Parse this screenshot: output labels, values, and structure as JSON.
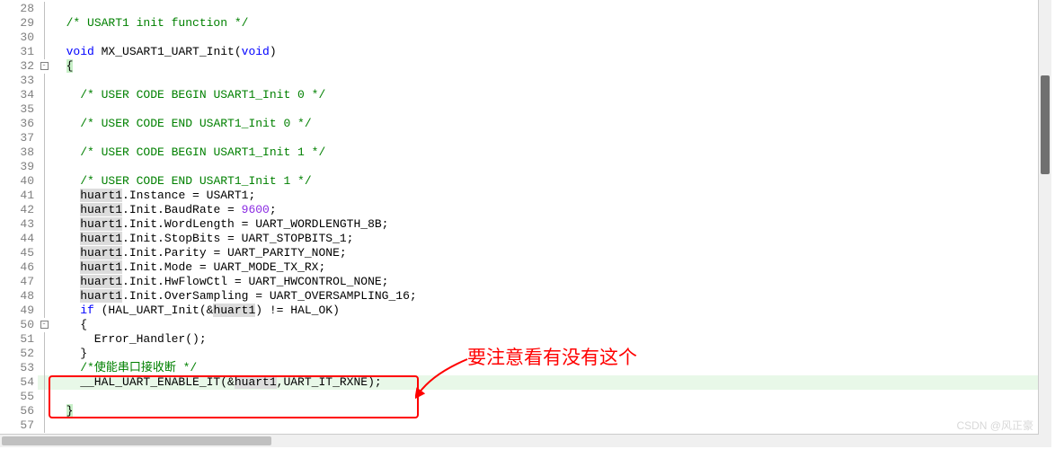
{
  "gutter_start": 28,
  "lines": [
    {
      "n": 28,
      "fold": "line",
      "segments": []
    },
    {
      "n": 29,
      "fold": "line",
      "segments": [
        {
          "t": "  ",
          "c": ""
        },
        {
          "t": "/* USART1 init function */",
          "c": "cmt"
        }
      ]
    },
    {
      "n": 30,
      "fold": "line",
      "segments": []
    },
    {
      "n": 31,
      "fold": "line",
      "segments": [
        {
          "t": "  ",
          "c": ""
        },
        {
          "t": "void",
          "c": "kw"
        },
        {
          "t": " MX_USART1_UART_Init(",
          "c": ""
        },
        {
          "t": "void",
          "c": "kw"
        },
        {
          "t": ")",
          "c": ""
        }
      ]
    },
    {
      "n": 32,
      "fold": "minus",
      "segments": [
        {
          "t": "  ",
          "c": ""
        },
        {
          "t": "{",
          "c": "bh"
        }
      ]
    },
    {
      "n": 33,
      "fold": "line",
      "segments": []
    },
    {
      "n": 34,
      "fold": "line",
      "segments": [
        {
          "t": "    ",
          "c": ""
        },
        {
          "t": "/* USER CODE BEGIN USART1_Init 0 */",
          "c": "cmt"
        }
      ]
    },
    {
      "n": 35,
      "fold": "line",
      "segments": []
    },
    {
      "n": 36,
      "fold": "line",
      "segments": [
        {
          "t": "    ",
          "c": ""
        },
        {
          "t": "/* USER CODE END USART1_Init 0 */",
          "c": "cmt"
        }
      ]
    },
    {
      "n": 37,
      "fold": "line",
      "segments": []
    },
    {
      "n": 38,
      "fold": "line",
      "segments": [
        {
          "t": "    ",
          "c": ""
        },
        {
          "t": "/* USER CODE BEGIN USART1_Init 1 */",
          "c": "cmt"
        }
      ]
    },
    {
      "n": 39,
      "fold": "line",
      "segments": []
    },
    {
      "n": 40,
      "fold": "line",
      "segments": [
        {
          "t": "    ",
          "c": ""
        },
        {
          "t": "/* USER CODE END USART1_Init 1 */",
          "c": "cmt"
        }
      ]
    },
    {
      "n": 41,
      "fold": "line",
      "segments": [
        {
          "t": "    ",
          "c": ""
        },
        {
          "t": "huart1",
          "c": "idh"
        },
        {
          "t": ".Instance = USART1;",
          "c": ""
        }
      ]
    },
    {
      "n": 42,
      "fold": "line",
      "segments": [
        {
          "t": "    ",
          "c": ""
        },
        {
          "t": "huart1",
          "c": "idh"
        },
        {
          "t": ".Init.BaudRate = ",
          "c": ""
        },
        {
          "t": "9600",
          "c": "num"
        },
        {
          "t": ";",
          "c": ""
        }
      ]
    },
    {
      "n": 43,
      "fold": "line",
      "segments": [
        {
          "t": "    ",
          "c": ""
        },
        {
          "t": "huart1",
          "c": "idh"
        },
        {
          "t": ".Init.WordLength = UART_WORDLENGTH_8B;",
          "c": ""
        }
      ]
    },
    {
      "n": 44,
      "fold": "line",
      "segments": [
        {
          "t": "    ",
          "c": ""
        },
        {
          "t": "huart1",
          "c": "idh"
        },
        {
          "t": ".Init.StopBits = UART_STOPBITS_1;",
          "c": ""
        }
      ]
    },
    {
      "n": 45,
      "fold": "line",
      "segments": [
        {
          "t": "    ",
          "c": ""
        },
        {
          "t": "huart1",
          "c": "idh"
        },
        {
          "t": ".Init.Parity = UART_PARITY_NONE;",
          "c": ""
        }
      ]
    },
    {
      "n": 46,
      "fold": "line",
      "segments": [
        {
          "t": "    ",
          "c": ""
        },
        {
          "t": "huart1",
          "c": "idh"
        },
        {
          "t": ".Init.Mode = UART_MODE_TX_RX;",
          "c": ""
        }
      ]
    },
    {
      "n": 47,
      "fold": "line",
      "segments": [
        {
          "t": "    ",
          "c": ""
        },
        {
          "t": "huart1",
          "c": "idh"
        },
        {
          "t": ".Init.HwFlowCtl = UART_HWCONTROL_NONE;",
          "c": ""
        }
      ]
    },
    {
      "n": 48,
      "fold": "line",
      "segments": [
        {
          "t": "    ",
          "c": ""
        },
        {
          "t": "huart1",
          "c": "idh"
        },
        {
          "t": ".Init.OverSampling = UART_OVERSAMPLING_16;",
          "c": ""
        }
      ]
    },
    {
      "n": 49,
      "fold": "line",
      "segments": [
        {
          "t": "    ",
          "c": ""
        },
        {
          "t": "if",
          "c": "kw"
        },
        {
          "t": " (HAL_UART_Init(&",
          "c": ""
        },
        {
          "t": "huart1",
          "c": "idh"
        },
        {
          "t": ") != HAL_OK)",
          "c": ""
        }
      ]
    },
    {
      "n": 50,
      "fold": "minus",
      "segments": [
        {
          "t": "    {",
          "c": ""
        }
      ]
    },
    {
      "n": 51,
      "fold": "line",
      "segments": [
        {
          "t": "      Error_Handler();",
          "c": ""
        }
      ]
    },
    {
      "n": 52,
      "fold": "end",
      "segments": [
        {
          "t": "    }",
          "c": ""
        }
      ]
    },
    {
      "n": 53,
      "fold": "line",
      "segments": [
        {
          "t": "    ",
          "c": ""
        },
        {
          "t": "/*使能串口接收断 */",
          "c": "cmt"
        }
      ]
    },
    {
      "n": 54,
      "fold": "line",
      "cursor": true,
      "segments": [
        {
          "t": "    __HAL_UART_ENABLE_IT(&",
          "c": ""
        },
        {
          "t": "huart1",
          "c": "idh"
        },
        {
          "t": ",UART_IT_RXNE);",
          "c": ""
        }
      ]
    },
    {
      "n": 55,
      "fold": "line",
      "segments": []
    },
    {
      "n": 56,
      "fold": "end",
      "segments": [
        {
          "t": "  ",
          "c": ""
        },
        {
          "t": "}",
          "c": "bh"
        }
      ]
    },
    {
      "n": 57,
      "fold": "line",
      "segments": []
    }
  ],
  "annotation_text": "要注意看有没有这个",
  "watermark": "CSDN @风正豪"
}
